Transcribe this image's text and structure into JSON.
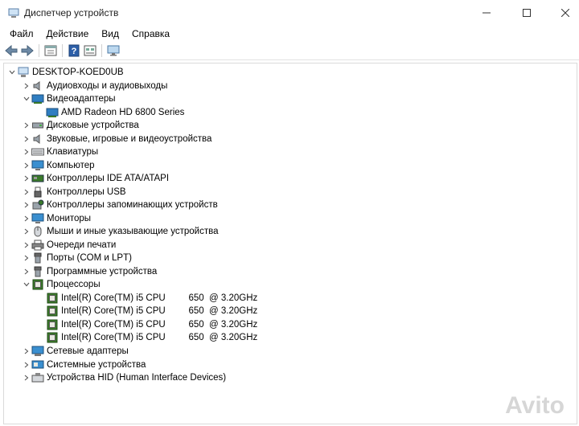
{
  "window": {
    "title": "Диспетчер устройств",
    "controls": {
      "minimize": "minimize-icon",
      "maximize": "maximize-icon",
      "close": "close-icon"
    }
  },
  "menu": {
    "file": "Файл",
    "action": "Действие",
    "view": "Вид",
    "help": "Справка"
  },
  "toolbar": {
    "icons": [
      "back-arrow-icon",
      "forward-arrow-icon",
      "properties-icon",
      "help-icon",
      "view-icon",
      "monitor-scan-icon"
    ]
  },
  "tree": {
    "root": "DESKTOP-KOED0UB",
    "categories": [
      {
        "label": "Аудиовходы и аудиовыходы",
        "icon": "speaker-icon",
        "expanded": false
      },
      {
        "label": "Видеоадаптеры",
        "icon": "display-adapter-icon",
        "expanded": true
      },
      {
        "label": "AMD Radeon HD 6800 Series",
        "icon": "display-adapter-icon",
        "child": true
      },
      {
        "label": "Дисковые устройства",
        "icon": "disk-drive-icon",
        "expanded": false
      },
      {
        "label": "Звуковые, игровые и видеоустройства",
        "icon": "sound-icon",
        "expanded": false
      },
      {
        "label": "Клавиатуры",
        "icon": "keyboard-icon",
        "expanded": false
      },
      {
        "label": "Компьютер",
        "icon": "computer-icon",
        "expanded": false
      },
      {
        "label": "Контроллеры IDE ATA/ATAPI",
        "icon": "ide-controller-icon",
        "expanded": false
      },
      {
        "label": "Контроллеры USB",
        "icon": "usb-icon",
        "expanded": false
      },
      {
        "label": "Контроллеры запоминающих устройств",
        "icon": "storage-controller-icon",
        "expanded": false
      },
      {
        "label": "Мониторы",
        "icon": "monitor-icon",
        "expanded": false
      },
      {
        "label": "Мыши и иные указывающие устройства",
        "icon": "mouse-icon",
        "expanded": false
      },
      {
        "label": "Очереди печати",
        "icon": "printer-icon",
        "expanded": false
      },
      {
        "label": "Порты (COM и LPT)",
        "icon": "port-icon",
        "expanded": false
      },
      {
        "label": "Программные устройства",
        "icon": "software-device-icon",
        "expanded": false
      },
      {
        "label": "Процессоры",
        "icon": "processor-icon",
        "expanded": true
      },
      {
        "label": "Intel(R) Core(TM) i5 CPU         650  @ 3.20GHz",
        "icon": "processor-icon",
        "child": true
      },
      {
        "label": "Intel(R) Core(TM) i5 CPU         650  @ 3.20GHz",
        "icon": "processor-icon",
        "child": true
      },
      {
        "label": "Intel(R) Core(TM) i5 CPU         650  @ 3.20GHz",
        "icon": "processor-icon",
        "child": true
      },
      {
        "label": "Intel(R) Core(TM) i5 CPU         650  @ 3.20GHz",
        "icon": "processor-icon",
        "child": true
      },
      {
        "label": "Сетевые адаптеры",
        "icon": "network-adapter-icon",
        "expanded": false
      },
      {
        "label": "Системные устройства",
        "icon": "system-device-icon",
        "expanded": false
      },
      {
        "label": "Устройства HID (Human Interface Devices)",
        "icon": "hid-icon",
        "expanded": false
      }
    ]
  },
  "watermark": "Avito",
  "colors": {
    "accent": "#1e6fc0",
    "processor": "#3c7a2c",
    "border": "#dadada"
  }
}
